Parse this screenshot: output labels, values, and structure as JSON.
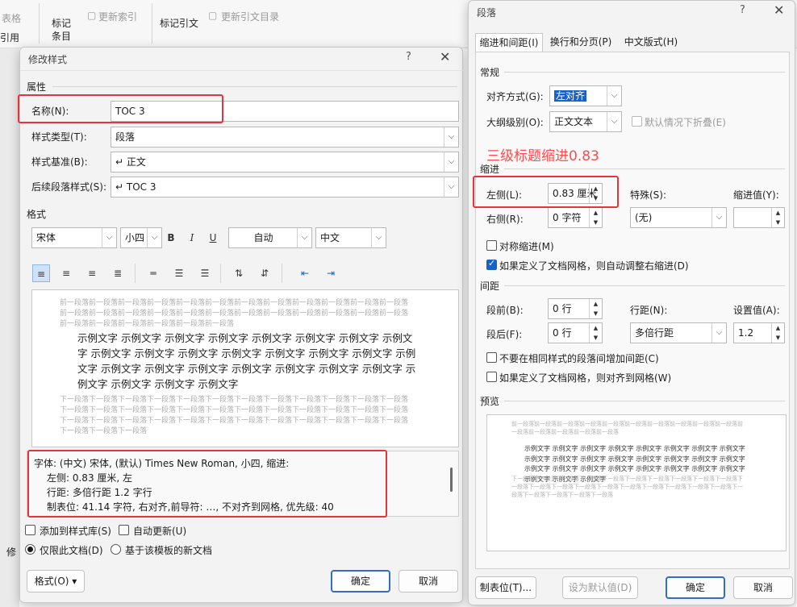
{
  "ribbon": {
    "label_yanlie": "表格",
    "label_yinyong": "引用",
    "mark_entry_line1": "标记",
    "mark_entry_line2": "条目",
    "update_index": "更新索引",
    "mark_citation": "标记引文",
    "update_citation_table": "更新引文目录",
    "left_partial": "修"
  },
  "modify_style": {
    "title": "修改样式",
    "help": "?",
    "close": "✕",
    "properties_label": "属性",
    "name_label": "名称(N):",
    "name_value": "TOC 3",
    "style_type_label": "样式类型(T):",
    "style_type_value": "段落",
    "based_on_label": "样式基准(B):",
    "based_on_value": "↵ 正文",
    "next_style_label": "后续段落样式(S):",
    "next_style_value": "↵ TOC 3",
    "format_label": "格式",
    "font_value": "宋体",
    "size_value": "小四",
    "bold": "B",
    "italic": "I",
    "underline": "U",
    "color_value": "自动",
    "script_value": "中文",
    "preview_prev": "前一段落前一段落前一段落前一段落前一段落前一段落前一段落前一段落前一段落前一段落前一段落前一段落前一段落前一段落前一段落前一段落前一段落前一段落前一段落前一段落前一段落前一段落前一段落前一段落前一段落前一段落前一段落前一段落前一段落前一段落",
    "preview_sample": "示例文字 示例文字 示例文字 示例文字 示例文字 示例文字 示例文字 示例文字 示例文字 示例文字 示例文字 示例文字 示例文字 示例文字 示例文字 示例文字 示例文字 示例文字 示例文字 示例文字 示例文字 示例文字 示例文字 示例文字 示例文字 示例文字 示例文字",
    "preview_next": "下一段落下一段落下一段落下一段落下一段落下一段落下一段落下一段落下一段落下一段落下一段落下一段落下一段落下一段落下一段落下一段落下一段落下一段落下一段落下一段落下一段落下一段落下一段落下一段落下一段落下一段落下一段落下一段落下一段落下一段落下一段落下一段落下一段落下一段落下一段落下一段落下一段落下一段落下一段落",
    "desc_line1": "字体: (中文) 宋体, (默认) Times New Roman, 小四, 缩进:",
    "desc_line2": "左侧:  0.83 厘米, 左",
    "desc_line3": "行距: 多倍行距 1.2 字行",
    "desc_line4": "制表位:  41.14 字符, 右对齐,前导符: …, 不对齐到网格, 优先级: 40",
    "add_to_gallery": "添加到样式库(S)",
    "auto_update": "自动更新(U)",
    "only_this_doc": "仅限此文档(D)",
    "new_docs_template": "基于该模板的新文档",
    "format_button": "格式(O) ▾",
    "ok": "确定",
    "cancel": "取消"
  },
  "paragraph": {
    "title": "段落",
    "help": "?",
    "close": "✕",
    "tab_indent_spacing": "缩进和间距(I)",
    "tab_line_page": "换行和分页(P)",
    "tab_chinese": "中文版式(H)",
    "general_label": "常规",
    "alignment_label": "对齐方式(G):",
    "alignment_value": "左对齐",
    "outline_label": "大纲级别(O):",
    "outline_value": "正文文本",
    "collapse_default": "默认情况下折叠(E)",
    "annotation": "三级标题缩进0.83",
    "indent_label": "缩进",
    "left_label": "左侧(L):",
    "left_value": "0.83 厘米",
    "right_label": "右侧(R):",
    "right_value": "0 字符",
    "special_label": "特殊(S):",
    "special_value": "(无)",
    "indent_by_label": "缩进值(Y):",
    "indent_by_value": "",
    "mirror_indent": "对称缩进(M)",
    "auto_adjust_right": "如果定义了文档网格，则自动调整右缩进(D)",
    "spacing_label": "间距",
    "before_label": "段前(B):",
    "before_value": "0 行",
    "after_label": "段后(F):",
    "after_value": "0 行",
    "line_spacing_label": "行距(N):",
    "line_spacing_value": "多倍行距",
    "at_label": "设置值(A):",
    "at_value": "1.2",
    "no_space_same_style": "不要在相同样式的段落间增加间距(C)",
    "snap_to_grid": "如果定义了文档网格，则对齐到网格(W)",
    "preview_label": "预览",
    "preview_prev": "前一段落前一段落前一段落前一段落前一段落前一段落前一段落前一段落前一段落前一段落前一段落前一段落前一段落前一段落前一段落",
    "preview_sample": "示例文字 示例文字 示例文字 示例文字 示例文字 示例文字 示例文字 示例文字 示例文字 示例文字 示例文字 示例文字 示例文字 示例文字 示例文字 示例文字 示例文字 示例文字 示例文字 示例文字 示例文字 示例文字 示例文字 示例文字 示例文字 示例文字 示例文字",
    "preview_next": "下一段落下一段落下一段落下一段落下一段落下一段落下一段落下一段落下一段落下一段落下一段落下一段落下一段落下一段落下一段落下一段落下一段落下一段落下一段落下一段落下一段落下一段落下一段落下一段落下一段落",
    "tabs_button": "制表位(T)...",
    "set_default": "设为默认值(D)",
    "ok": "确定",
    "cancel": "取消"
  },
  "colors": {
    "highlight": "#e5353c",
    "accent": "#2f6fc5",
    "selected_fill": "#1a63c6"
  }
}
